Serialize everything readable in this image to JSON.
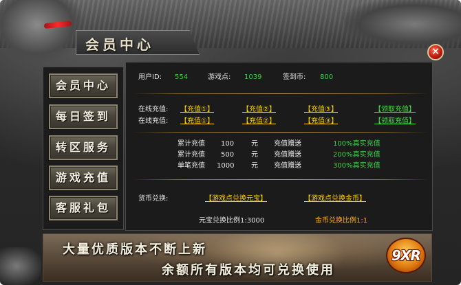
{
  "window": {
    "title": "会员中心",
    "close_glyph": "✕"
  },
  "nav": {
    "items": [
      {
        "label": "会员中心"
      },
      {
        "label": "每日签到"
      },
      {
        "label": "转区服务"
      },
      {
        "label": "游戏充值"
      },
      {
        "label": "客服礼包"
      }
    ]
  },
  "user_info": {
    "user_id_label": "用户ID:",
    "user_id_value": "554",
    "game_points_label": "游戏点:",
    "game_points_value": "1039",
    "signin_coins_label": "签到币:",
    "signin_coins_value": "800"
  },
  "recharge": {
    "rows": [
      {
        "label": "在线充值:",
        "links": [
          "【充值①】",
          "【充值②】",
          "【充值③】"
        ],
        "claim": "【领取充值】"
      },
      {
        "label": "在线充值:",
        "links": [
          "【充值①】",
          "【充值②】",
          "【充值③】"
        ],
        "claim": "【领取充值】"
      }
    ]
  },
  "bonus": {
    "rows": [
      {
        "type": "累计充值",
        "amount": "100",
        "unit": "元",
        "gift": "充值赠送",
        "percent": "100%真实充值"
      },
      {
        "type": "累计充值",
        "amount": "500",
        "unit": "元",
        "gift": "充值赠送",
        "percent": "200%真实充值"
      },
      {
        "type": "单笔充值",
        "amount": "1000",
        "unit": "元",
        "gift": "充值赠送",
        "percent": "300%真实充值"
      }
    ]
  },
  "exchange": {
    "label": "货币兑换:",
    "to_yuanbao": "【游戏点兑换元宝】",
    "to_gold": "【游戏点兑换金币】",
    "yuanbao_ratio": "元宝兑换比例1:3000",
    "gold_ratio": "金币兑换比例1:1"
  },
  "banner": {
    "line1": "大量优质版本不断上新",
    "line2": "余额所有版本均可兑换使用",
    "logo": "9XR"
  },
  "colors": {
    "green_value": "#3fd04a",
    "yellow_link": "#ffd400",
    "lime_link": "#40e040",
    "orange_ratio": "#ffb020",
    "close_red": "#c01a10"
  }
}
